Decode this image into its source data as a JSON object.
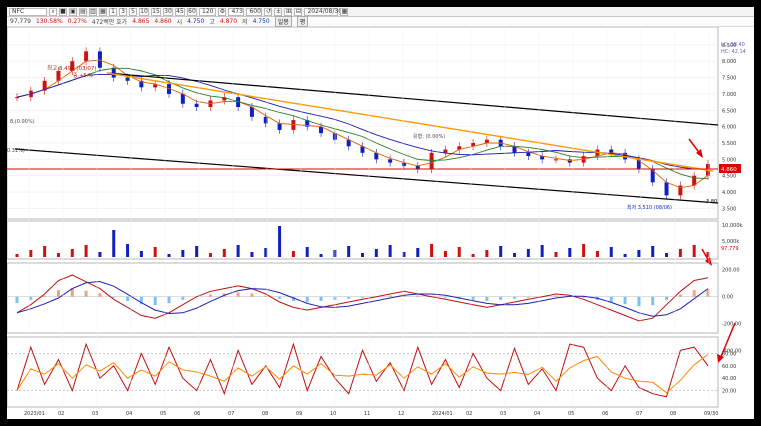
{
  "toolbar": {
    "code": "NFC",
    "periods": [
      "1",
      "3",
      "5",
      "10",
      "15",
      "30",
      "45",
      "60",
      "120"
    ],
    "count": "473",
    "count2": "600",
    "date": "2024/08/30"
  },
  "info": {
    "vol_value": "97,779",
    "vol_change": "130.58%",
    "rate": "0.27%",
    "desc": "472백만 호가",
    "ask": "4.865",
    "bid": "4.860",
    "open_label": "시",
    "open": "4.750",
    "high_label": "고",
    "high": "4.870",
    "low_label": "저",
    "low": "4.750",
    "btn1": "일봉",
    "btn2": "평"
  },
  "colors": {
    "up": "#d01010",
    "down": "#1020c0",
    "channel": "#000000",
    "resistance": "#ff9900",
    "support": "#e00000",
    "ma_short": "#2a7a2a",
    "ma_long": "#1a1ab4"
  },
  "price_panel": {
    "legend1": "LC: 38.40",
    "legend2": "HC: 42.14",
    "high_marker": "최고 8,490 (03/07)",
    "high_marker_sub": "증.+5.%",
    "low_marker": "최저 3,510 (08/06)",
    "note_left": "8,(0.00%)",
    "note_left2": "0.31%)",
    "note_mid": "유형: (0.00%)",
    "right_value": "3.80",
    "current_price": "4.860"
  },
  "volume_panel": {
    "current": "97,779"
  },
  "x_axis_labels": [
    "2023/01",
    "02",
    "03",
    "04",
    "05",
    "06",
    "07",
    "08",
    "09",
    "10",
    "11",
    "12",
    "2024/01",
    "02",
    "03",
    "04",
    "05",
    "06",
    "07",
    "08",
    "09/30"
  ],
  "chart_data": {
    "type": "line",
    "price_axis": [
      "8.500",
      "8.000",
      "7.500",
      "7.000",
      "6.500",
      "6.000",
      "5.500",
      "5.000",
      "4.500",
      "4.000",
      "3.500"
    ],
    "price_ylim": [
      3.3,
      8.8
    ],
    "volume_axis": [
      "10,000k",
      "5,000k"
    ],
    "macd_axis": [
      "200.00",
      "0.00",
      "-200.00",
      "-400.00"
    ],
    "stoch_axis": [
      "80.00",
      "60.00",
      "40.00",
      "20.00"
    ],
    "close_series": [
      6.9,
      7.1,
      7.4,
      7.7,
      8.0,
      8.3,
      7.8,
      7.5,
      7.4,
      7.2,
      7.3,
      7.0,
      6.7,
      6.6,
      6.8,
      6.9,
      6.6,
      6.3,
      6.1,
      5.9,
      6.2,
      6.0,
      5.8,
      5.6,
      5.4,
      5.2,
      5.0,
      4.9,
      4.8,
      4.7,
      5.2,
      5.3,
      5.4,
      5.5,
      5.6,
      5.4,
      5.2,
      5.1,
      5.0,
      5.0,
      4.9,
      5.1,
      5.3,
      5.2,
      5.0,
      4.7,
      4.3,
      3.9,
      4.2,
      4.5,
      4.86
    ],
    "stoch_k": [
      20,
      90,
      30,
      70,
      20,
      95,
      40,
      60,
      20,
      80,
      30,
      90,
      40,
      20,
      70,
      15,
      85,
      30,
      60,
      25,
      95,
      20,
      75,
      40,
      15,
      85,
      35,
      65,
      20,
      90,
      30,
      70,
      25,
      80,
      40,
      20,
      88,
      30,
      55,
      20,
      95,
      90,
      40,
      20,
      60,
      25,
      15,
      10,
      85,
      90,
      60
    ],
    "macd_series": [
      -120,
      -60,
      20,
      120,
      160,
      110,
      60,
      -20,
      -80,
      -140,
      -160,
      -120,
      -60,
      0,
      40,
      60,
      80,
      60,
      20,
      -40,
      -80,
      -100,
      -80,
      -60,
      -40,
      -20,
      0,
      20,
      40,
      20,
      0,
      -20,
      -40,
      -60,
      -80,
      -60,
      -40,
      -20,
      0,
      20,
      10,
      -20,
      -60,
      -100,
      -140,
      -180,
      -160,
      -60,
      40,
      120,
      140
    ]
  }
}
